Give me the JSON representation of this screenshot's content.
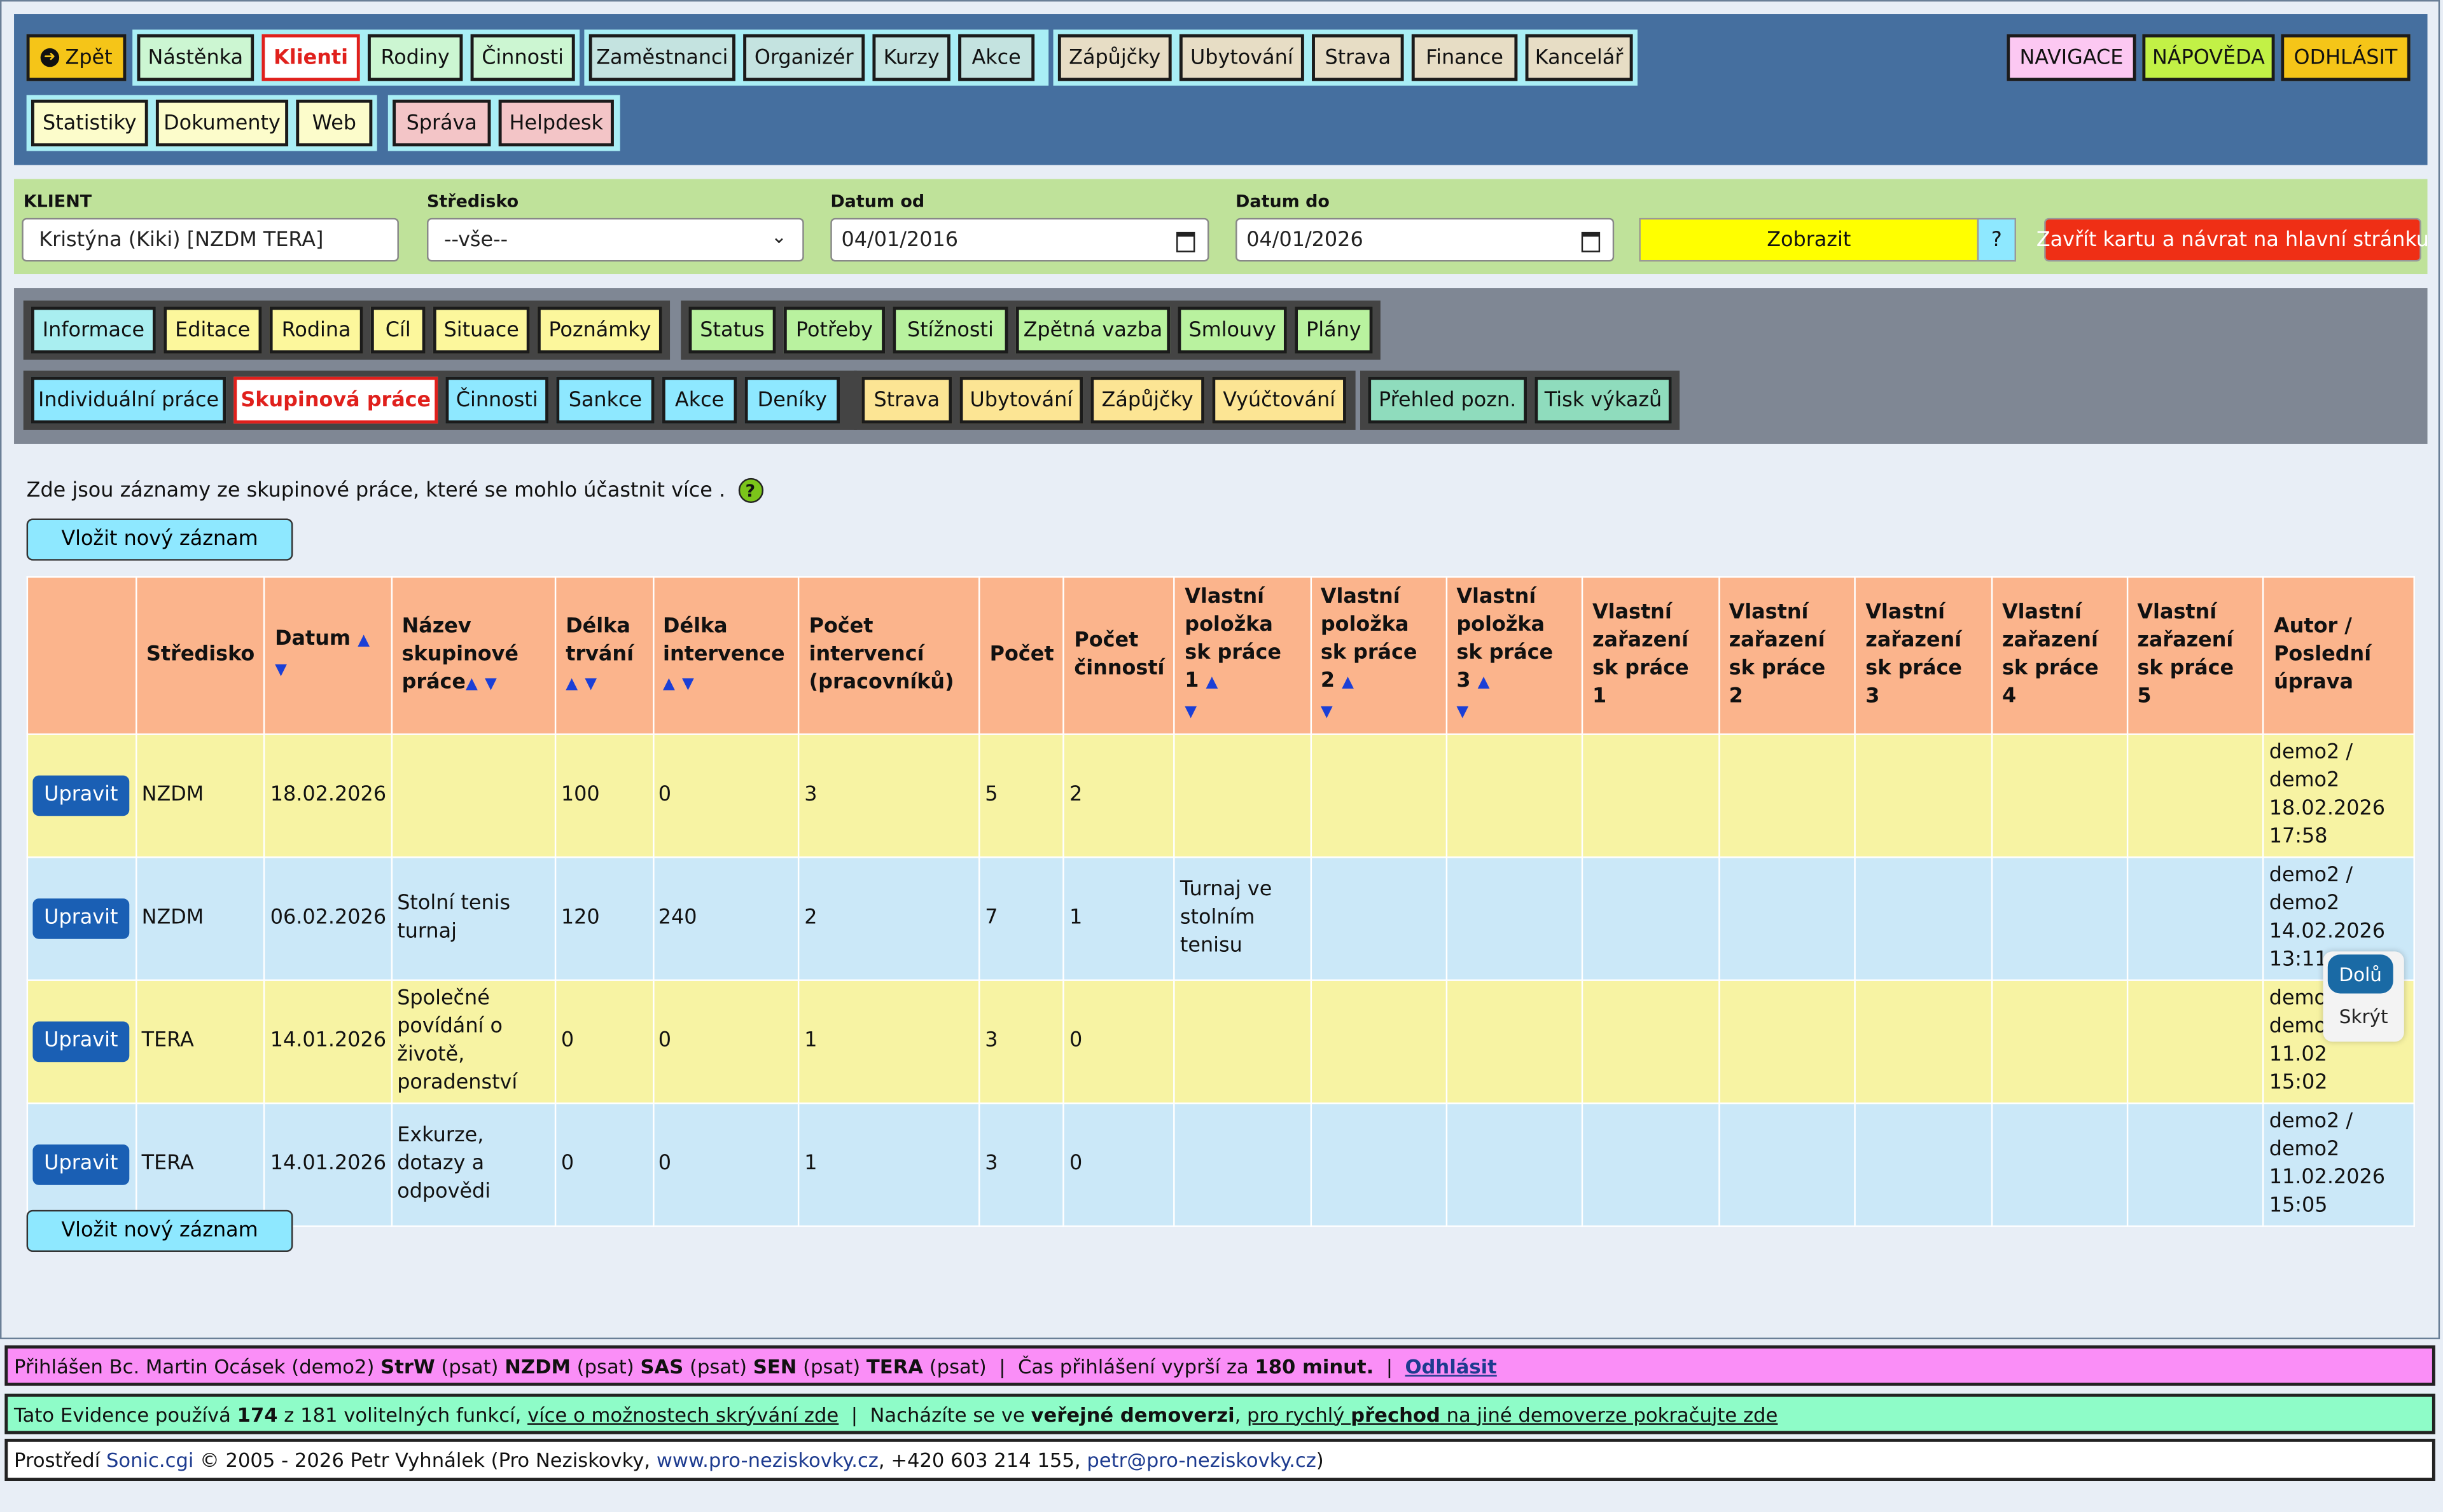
{
  "topnav": {
    "back": "Zpět",
    "row1_group1": [
      "Nástěnka",
      "Klienti",
      "Rodiny",
      "Činnosti"
    ],
    "row1_group2": [
      "Zaměstnanci",
      "Organizér",
      "Kurzy",
      "Akce"
    ],
    "row1_group3": [
      "Zápůjčky",
      "Ubytování",
      "Strava",
      "Finance",
      "Kancelář"
    ],
    "right": [
      "NAVIGACE",
      "NÁPOVĚDA",
      "ODHLÁSIT"
    ],
    "row2_group1": [
      "Statistiky",
      "Dokumenty",
      "Web"
    ],
    "row2_group2": [
      "Správa",
      "Helpdesk"
    ]
  },
  "filter": {
    "client_label": "KLIENT",
    "client_value": "Kristýna (Kiki) [NZDM TERA]",
    "center_label": "Středisko",
    "center_value": "--vše--",
    "date_from_label": "Datum od",
    "date_from": "04/01/2016",
    "date_to_label": "Datum do",
    "date_to": "04/01/2026",
    "show": "Zobrazit",
    "help": "?",
    "close": "Zavřít kartu a návrat na hlavní stránku"
  },
  "tabs": {
    "row1_g1": [
      "Informace",
      "Editace",
      "Rodina",
      "Cíl",
      "Situace",
      "Poznámky"
    ],
    "row1_g2": [
      "Status",
      "Potřeby",
      "Stížnosti",
      "Zpětná vazba",
      "Smlouvy",
      "Plány"
    ],
    "row2_g1": [
      "Individuální práce",
      "Skupinová práce",
      "Činnosti",
      "Sankce",
      "Akce",
      "Deníky"
    ],
    "row2_g2": [
      "Strava",
      "Ubytování",
      "Zápůjčky",
      "Vyúčtování"
    ],
    "row2_g3": [
      "Přehled pozn.",
      "Tisk výkazů"
    ]
  },
  "intro": "Zde jsou záznamy ze skupinové práce, které se mohlo účastnit více .",
  "help_icon": "?",
  "new_record": "Vložit nový záznam",
  "table": {
    "headers": {
      "stredisko": "Středisko",
      "datum": "Datum",
      "nazev": "Název skupinové práce",
      "delka": "Délka trvání",
      "intervence": "Délka intervence",
      "pocet_int": "Počet intervencí (pracovníků)",
      "pocet": "Počet",
      "pocet_cin": "Počet činností",
      "vp1": "Vlastní položka sk práce 1",
      "vp2": "Vlastní položka sk práce 2",
      "vp3": "Vlastní položka sk práce 3",
      "vz1": "Vlastní zařazení sk práce 1",
      "vz2": "Vlastní zařazení sk práce 2",
      "vz3": "Vlastní zařazení sk práce 3",
      "vz4": "Vlastní zařazení sk práce 4",
      "vz5": "Vlastní zařazení sk práce 5",
      "autor": "Autor / Poslední úprava"
    },
    "edit_label": "Upravit",
    "rows": [
      {
        "stredisko": "NZDM",
        "datum": "18.02.2026",
        "nazev": "",
        "delka": "100",
        "intervence": "0",
        "pocet_int": "3",
        "pocet": "5",
        "pocet_cin": "2",
        "vp1": "",
        "autor": [
          "demo2 /",
          "demo2",
          "18.02.2026",
          "17:58"
        ]
      },
      {
        "stredisko": "NZDM",
        "datum": "06.02.2026",
        "nazev": "Stolní tenis turnaj",
        "delka": "120",
        "intervence": "240",
        "pocet_int": "2",
        "pocet": "7",
        "pocet_cin": "1",
        "vp1": "Turnaj ve stolním tenisu",
        "autor": [
          "demo2 /",
          "demo2",
          "14.02.2026",
          "13:11"
        ]
      },
      {
        "stredisko": "TERA",
        "datum": "14.01.2026",
        "nazev": "Společné povídání o životě, poradenství",
        "delka": "0",
        "intervence": "0",
        "pocet_int": "1",
        "pocet": "3",
        "pocet_cin": "0",
        "vp1": "",
        "autor": [
          "demo",
          "demo",
          "11.02",
          "15:02"
        ]
      },
      {
        "stredisko": "TERA",
        "datum": "14.01.2026",
        "nazev": "Exkurze, dotazy a odpovědi",
        "delka": "0",
        "intervence": "0",
        "pocet_int": "1",
        "pocet": "3",
        "pocet_cin": "0",
        "vp1": "",
        "autor": [
          "demo2 /",
          "demo2",
          "11.02.2026",
          "15:05"
        ]
      }
    ]
  },
  "float": {
    "down": "Dolů",
    "hide": "Skrýt"
  },
  "footer": {
    "line1": {
      "pre": "Přihlášen Bc. Martin Ocásek (demo2) ",
      "b1": "StrW",
      "t1": " (psat) ",
      "b2": "NZDM",
      "t2": " (psat) ",
      "b3": "SAS",
      "t3": " (psat) ",
      "b4": "SEN",
      "t4": " (psat) ",
      "b5": "TERA",
      "t5": " (psat)  |  Čas přihlášení vyprší za ",
      "b6": "180 minut.",
      "t6": "  |  ",
      "link": "Odhlásit"
    },
    "line2": {
      "pre": "Tato Evidence používá ",
      "b1": "174",
      "t1": " z 181 volitelných funkcí, ",
      "link1": "více o možnostech skrývání zde",
      "t2": "  |  Nacházíte se ve ",
      "b2": "veřejné demoverzi",
      "t3": ", ",
      "link2a": "pro rychlý ",
      "link2b": "přechod",
      "link2c": " na jiné demoverze pokračujte zde"
    },
    "line3": {
      "pre": "Prostředí ",
      "l1": "Sonic.cgi",
      "t1": " © 2005 - 2026 Petr Vyhnálek (Pro Neziskovky, ",
      "l2": "www.pro-neziskovky.cz",
      "t2": ", +420 603 214 155, ",
      "l3": "petr@pro-neziskovky.cz",
      "t3": ")"
    }
  },
  "colors": {
    "nav_bg": "#456f9f",
    "filter_bg": "#bfe29a",
    "tabs_bg": "#7f8794",
    "header": "#fbb48c",
    "row_yellow": "#f7f3a3",
    "row_blue": "#cbe8f8",
    "active_red": "#e0201c"
  }
}
